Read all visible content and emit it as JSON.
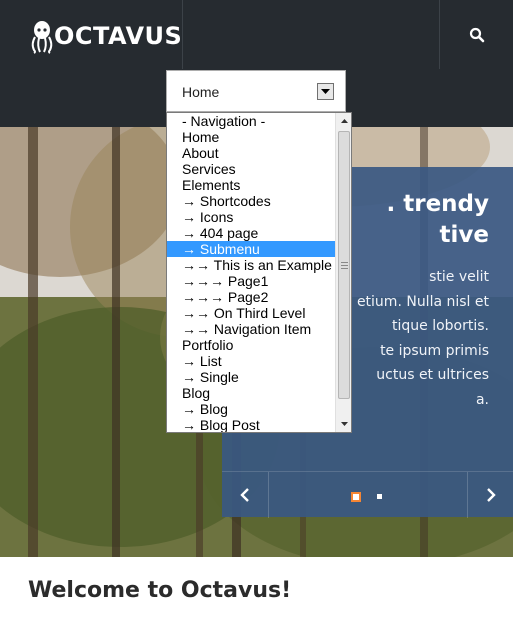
{
  "header": {
    "logo_text": "OCTAVUS",
    "icons": {
      "logo": "octopus-logo-icon",
      "search": "search-icon"
    }
  },
  "menu_select": {
    "value": "Home",
    "options": [
      "- Navigation -",
      "Home",
      "About",
      "Services",
      "Elements",
      "→ Shortcodes",
      "→ Icons",
      "→ 404 page",
      "→ Submenu",
      "→→ This is an Example",
      "→→→ Page1",
      "→→→ Page2",
      "→→ On Third Level",
      "→→ Navigation Item",
      "Portfolio",
      "→ List",
      "→ Single",
      "Blog",
      "→ Blog",
      "→ Blog Post"
    ],
    "selected_index": 8
  },
  "hero": {
    "title_lines": [
      ". trendy",
      "tive"
    ],
    "text_lines": [
      "stie velit",
      "etium. Nulla nisl et",
      "tique lobortis.",
      "te ipsum primis",
      "uctus et ultrices",
      "a."
    ],
    "slider_active": 1,
    "slider_count": 2
  },
  "main": {
    "welcome_title": "Welcome to Octavus!"
  },
  "colors": {
    "header_bg": "#262b30",
    "slide_bg": "#3a5882",
    "accent": "#f58634",
    "selection": "#3399ff"
  }
}
